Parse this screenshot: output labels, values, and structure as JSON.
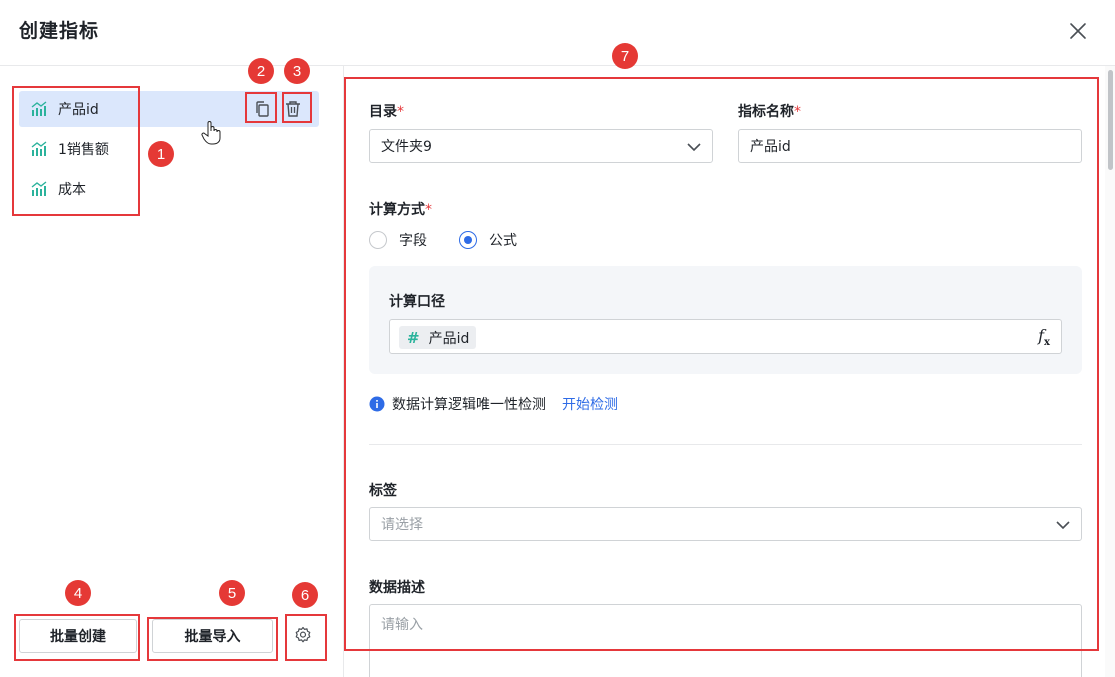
{
  "dialog": {
    "title": "创建指标"
  },
  "metrics": [
    {
      "label": "产品id",
      "selected": true
    },
    {
      "label": "1销售额",
      "selected": false
    },
    {
      "label": "成本",
      "selected": false
    }
  ],
  "footer": {
    "batch_create": "批量创建",
    "batch_import": "批量导入"
  },
  "annotations": [
    "1",
    "2",
    "3",
    "4",
    "5",
    "6",
    "7"
  ],
  "form": {
    "catalog": {
      "label": "目录",
      "required": "*",
      "value": "文件夹9"
    },
    "name": {
      "label": "指标名称",
      "required": "*",
      "value": "产品id"
    },
    "calc_method": {
      "label": "计算方式",
      "required": "*",
      "options": [
        {
          "label": "字段",
          "checked": false
        },
        {
          "label": "公式",
          "checked": true
        }
      ]
    },
    "calc_caliber": {
      "label": "计算口径",
      "chip_symbol": "#",
      "chip_label": "产品id",
      "fx": "f",
      "fx_sub": "x"
    },
    "uniqueness": {
      "text": "数据计算逻辑唯一性检测",
      "link": "开始检测"
    },
    "tags": {
      "label": "标签",
      "placeholder": "请选择"
    },
    "description": {
      "label": "数据描述",
      "placeholder": "请输入"
    }
  },
  "colors": {
    "accent": "#2e6be6",
    "annotation": "#e5383b",
    "metric_icon": "#2bb39c"
  },
  "icons": [
    "close-icon",
    "metric-icon",
    "copy-icon",
    "trash-icon",
    "gear-icon",
    "chevron-down-icon",
    "info-icon",
    "hand-cursor-icon"
  ]
}
